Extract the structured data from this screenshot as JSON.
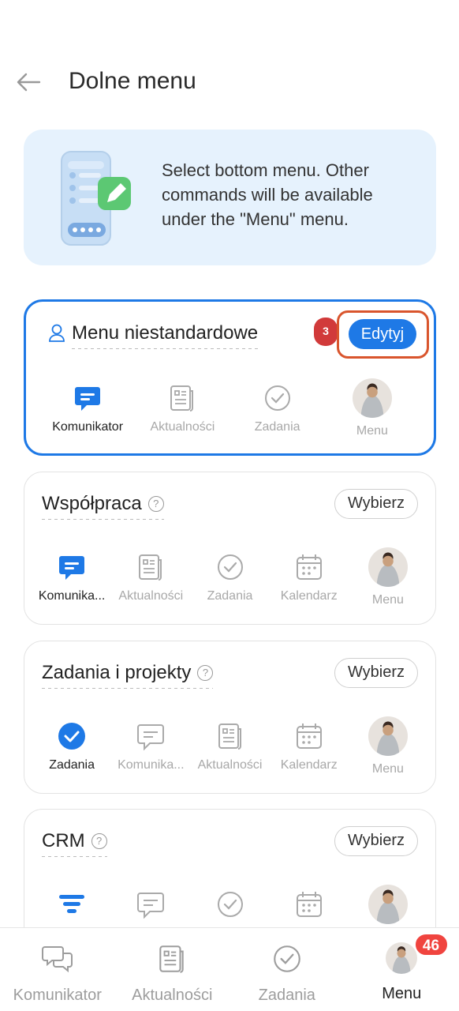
{
  "header": {
    "title": "Dolne menu",
    "back_icon": "arrow-left-icon"
  },
  "banner": {
    "text": "Select bottom menu. Other commands will be available under the \"Menu\" menu."
  },
  "presets": [
    {
      "title": "Menu niestandardowe",
      "button": "Edytyj",
      "step_marker": "3",
      "items": [
        "Komunikator",
        "Aktualności",
        "Zadania",
        "Menu"
      ]
    },
    {
      "title": "Współpraca",
      "button": "Wybierz",
      "items": [
        "Komunika...",
        "Aktualności",
        "Zadania",
        "Kalendarz",
        "Menu"
      ]
    },
    {
      "title": "Zadania i projekty",
      "button": "Wybierz",
      "items": [
        "Zadania",
        "Komunika...",
        "Aktualności",
        "Kalendarz",
        "Menu"
      ]
    },
    {
      "title": "CRM",
      "button": "Wybierz",
      "items": [
        "",
        "",
        "",
        "",
        ""
      ]
    }
  ],
  "bottom_nav": {
    "items": [
      "Komunikator",
      "Aktualności",
      "Zadania",
      "Menu"
    ],
    "badge": "46",
    "active": "Menu"
  },
  "colors": {
    "accent": "#1e79e6",
    "badge": "#f0443f",
    "highlight": "#d9552d"
  }
}
